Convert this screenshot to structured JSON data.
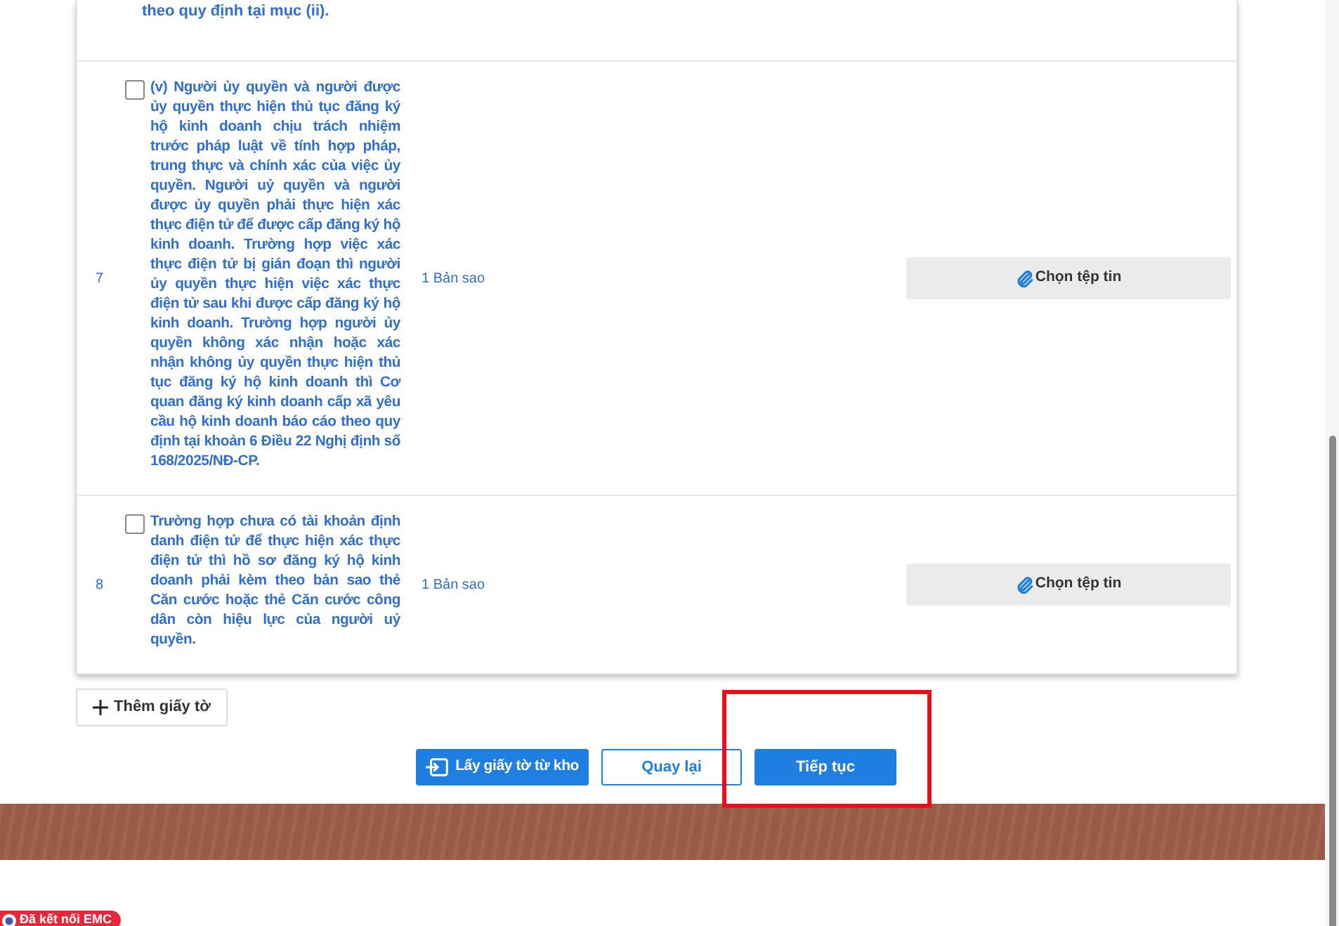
{
  "partial_row": {
    "text": "theo quy định tại mục (ii)."
  },
  "rows": [
    {
      "index": "7",
      "checked": false,
      "text": "(v) Người ủy quyền và người được ủy quyền thực hiện thủ tục đăng ký hộ kinh doanh chịu trách nhiệm trước pháp luật về tính hợp pháp, trung thực và chính xác của việc ủy quyền. Người uỷ quyền và người được ủy quyền phải thực hiện xác thực điện tử để được cấp đăng ký hộ kinh doanh. Trường hợp việc xác thực điện tử bị gián đoạn thì người ủy quyền thực hiện việc xác thực điện tử sau khi được cấp đăng ký hộ kinh doanh. Trường hợp người ủy quyền không xác nhận hoặc xác nhận không ủy quyền thực hiện thủ tục đăng ký hộ kinh doanh thì Cơ quan đăng ký kinh doanh cấp xã yêu cầu hộ kinh doanh báo cáo theo quy định tại khoản 6 Điều 22 Nghị định số 168/2025/NĐ-CP.",
      "copies": "1 Bản sao",
      "button": "Chọn tệp tin"
    },
    {
      "index": "8",
      "checked": false,
      "text": "Trường hợp chưa có tài khoản định danh điện tử để thực hiện xác thực điện tử thì hồ sơ đăng ký hộ kinh doanh phải kèm theo bản sao thẻ Căn cước hoặc thẻ Căn cước công dân còn hiệu lực của người uỷ quyền.",
      "copies": "1 Bản sao",
      "button": "Chọn tệp tin"
    }
  ],
  "add_button": {
    "label": "Thêm giấy tờ"
  },
  "actions": [
    {
      "kind": "primary-icon",
      "label": "Lấy giấy tờ từ kho",
      "highlighted": false
    },
    {
      "kind": "outline",
      "label": "Quay lại",
      "highlighted": false
    },
    {
      "kind": "primary",
      "label": "Tiếp tục",
      "highlighted": true
    }
  ],
  "status_badge": {
    "label": "Đã kết nối EMC"
  }
}
